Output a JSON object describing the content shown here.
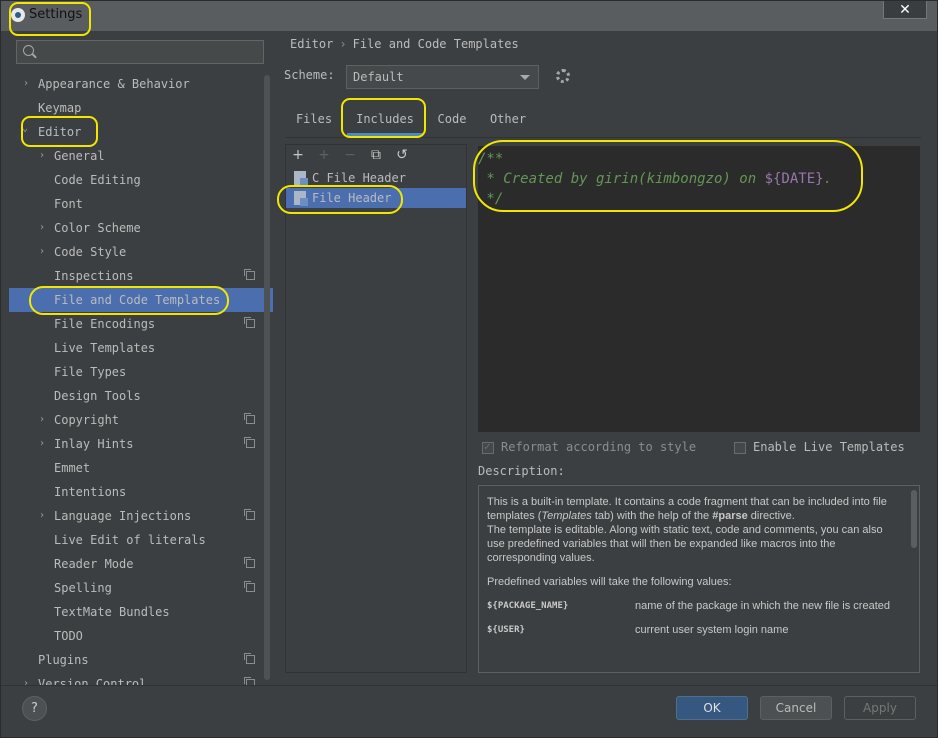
{
  "window": {
    "title": "Settings",
    "close_label": "✕"
  },
  "search": {
    "placeholder": ""
  },
  "sidebar": {
    "items": [
      {
        "label": "Appearance & Behavior",
        "expander": "›"
      },
      {
        "label": "Keymap"
      },
      {
        "label": "Editor",
        "expander": "⌄"
      },
      {
        "label": "General",
        "expander": "›"
      },
      {
        "label": "Code Editing"
      },
      {
        "label": "Font"
      },
      {
        "label": "Color Scheme",
        "expander": "›"
      },
      {
        "label": "Code Style",
        "expander": "›"
      },
      {
        "label": "Inspections"
      },
      {
        "label": "File and Code Templates"
      },
      {
        "label": "File Encodings"
      },
      {
        "label": "Live Templates"
      },
      {
        "label": "File Types"
      },
      {
        "label": "Design Tools"
      },
      {
        "label": "Copyright",
        "expander": "›"
      },
      {
        "label": "Inlay Hints",
        "expander": "›"
      },
      {
        "label": "Emmet"
      },
      {
        "label": "Intentions"
      },
      {
        "label": "Language Injections",
        "expander": "›"
      },
      {
        "label": "Live Edit of literals"
      },
      {
        "label": "Reader Mode"
      },
      {
        "label": "Spelling"
      },
      {
        "label": "TextMate Bundles"
      },
      {
        "label": "TODO"
      },
      {
        "label": "Plugins"
      },
      {
        "label": "Version Control",
        "expander": "›"
      }
    ]
  },
  "breadcrumb": {
    "parent": "Editor",
    "separator": "›",
    "current": "File and Code Templates"
  },
  "scheme": {
    "label": "Scheme:",
    "value": "Default"
  },
  "tabs": [
    {
      "label": "Files"
    },
    {
      "label": "Includes"
    },
    {
      "label": "Code"
    },
    {
      "label": "Other"
    }
  ],
  "toolbar": {
    "add": "+",
    "add_child": "+",
    "remove": "−",
    "copy": "⧉",
    "reset": "↺"
  },
  "templates": [
    {
      "label": "C File Header"
    },
    {
      "label": "File Header"
    }
  ],
  "editor": {
    "line1": "/**",
    "line2_prefix": " * Created by girin(kimbongzo) on ",
    "line2_var": "${DATE}",
    "line2_suffix": ".",
    "line3": " */"
  },
  "options": {
    "reformat_label": "Reformat according to style",
    "live_templates_label": "Enable Live Templates"
  },
  "description": {
    "label": "Description:",
    "p1_a": "This is a built-in template. It contains a code fragment that can be included into file templates (",
    "p1_b": "Templates",
    "p1_c": " tab) with the help of the ",
    "p1_d": "#parse",
    "p1_e": " directive.",
    "p2": "The template is editable. Along with static text, code and comments, you can also use predefined variables that will then be expanded like macros into the corresponding values.",
    "p3": "Predefined variables will take the following values:",
    "vars": [
      {
        "name": "${PACKAGE_NAME}",
        "desc": "name of the package in which the new file is created"
      },
      {
        "name": "${USER}",
        "desc": "current user system login name"
      }
    ]
  },
  "buttons": {
    "help": "?",
    "ok": "OK",
    "cancel": "Cancel",
    "apply": "Apply"
  },
  "colors": {
    "accent": "#4b6eaf",
    "highlight": "#f2e600",
    "comment": "#629755",
    "variable": "#9876aa"
  }
}
